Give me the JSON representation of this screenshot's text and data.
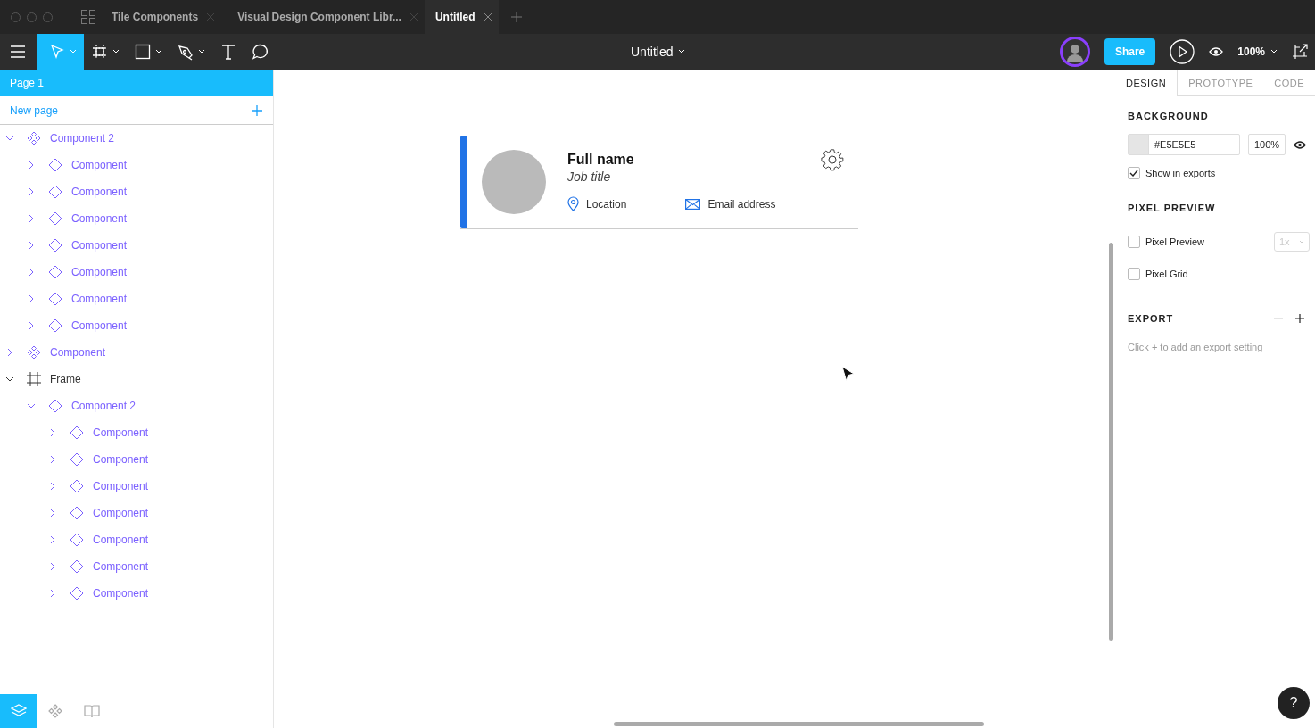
{
  "tabs": [
    {
      "label": "Tile Components",
      "selected": false
    },
    {
      "label": "Visual Design Component Libr...",
      "selected": false
    },
    {
      "label": "Untitled",
      "selected": true
    }
  ],
  "toolbar": {
    "tools": [
      {
        "kind": "move",
        "selected": true,
        "menu": true
      },
      {
        "kind": "frame",
        "selected": false,
        "menu": true
      },
      {
        "kind": "rectangle",
        "selected": false,
        "menu": true
      },
      {
        "kind": "pen",
        "selected": false,
        "menu": true
      },
      {
        "kind": "text",
        "selected": false,
        "menu": false
      },
      {
        "kind": "comment",
        "selected": false,
        "menu": false
      }
    ],
    "file_name": "Untitled",
    "share": "Share",
    "zoom": "100%"
  },
  "pages": {
    "items": [
      {
        "label": "Page 1",
        "selected": true
      }
    ],
    "new_page": "New page"
  },
  "layers": [
    {
      "label": "Component 2",
      "kind": "component-set",
      "expanded": true,
      "children": [
        {
          "label": "Component",
          "kind": "component",
          "expanded": false
        },
        {
          "label": "Component",
          "kind": "component",
          "expanded": false
        },
        {
          "label": "Component",
          "kind": "component",
          "expanded": false
        },
        {
          "label": "Component",
          "kind": "component",
          "expanded": false
        },
        {
          "label": "Component",
          "kind": "component",
          "expanded": false
        },
        {
          "label": "Component",
          "kind": "component",
          "expanded": false
        },
        {
          "label": "Component",
          "kind": "component",
          "expanded": false
        }
      ]
    },
    {
      "label": "Component",
      "kind": "component-set",
      "expanded": false
    },
    {
      "label": "Frame",
      "kind": "frame",
      "expanded": true,
      "children": [
        {
          "label": "Component 2",
          "kind": "component",
          "expanded": true,
          "children": [
            {
              "label": "Component",
              "kind": "component",
              "expanded": false
            },
            {
              "label": "Component",
              "kind": "component",
              "expanded": false
            },
            {
              "label": "Component",
              "kind": "component",
              "expanded": false
            },
            {
              "label": "Component",
              "kind": "component",
              "expanded": false
            },
            {
              "label": "Component",
              "kind": "component",
              "expanded": false
            },
            {
              "label": "Component",
              "kind": "component",
              "expanded": false
            },
            {
              "label": "Component",
              "kind": "component",
              "expanded": false
            }
          ]
        }
      ]
    }
  ],
  "canvas": {
    "card": {
      "name": "Full name",
      "job_title": "Job title",
      "location": "Location",
      "email": "Email address"
    }
  },
  "inspector": {
    "tabs": [
      {
        "label": "DESIGN",
        "selected": true
      },
      {
        "label": "PROTOTYPE",
        "selected": false
      },
      {
        "label": "CODE",
        "selected": false
      }
    ],
    "background": {
      "title": "BACKGROUND",
      "hex": "#E5E5E5",
      "opacity": "100%",
      "show_in_exports": {
        "label": "Show in exports",
        "checked": true
      }
    },
    "pixel_preview": {
      "title": "PIXEL PREVIEW",
      "options": [
        {
          "label": "Pixel Preview",
          "checked": false
        },
        {
          "label": "Pixel Grid",
          "checked": false
        }
      ],
      "scale": "1x"
    },
    "export": {
      "title": "EXPORT",
      "hint": "Click + to add an export setting"
    }
  },
  "bottom_tabs": [
    {
      "kind": "layers",
      "selected": true
    },
    {
      "kind": "components",
      "selected": false
    },
    {
      "kind": "library",
      "selected": false
    }
  ],
  "help": "?"
}
